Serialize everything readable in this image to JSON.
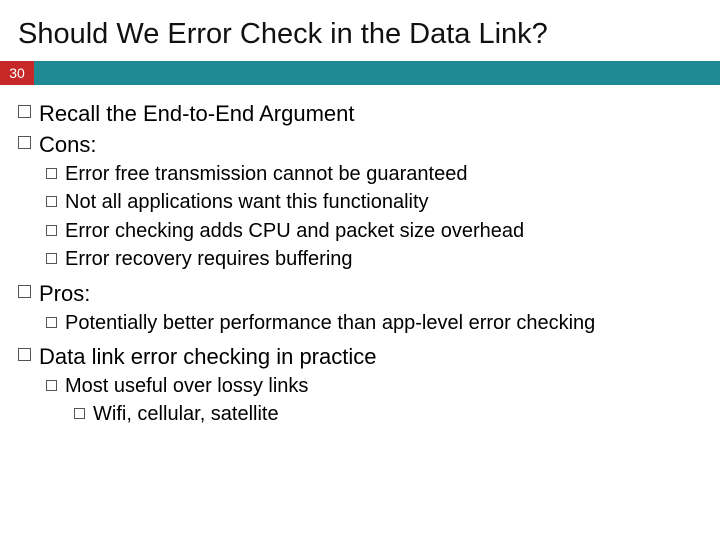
{
  "slide_number": "30",
  "title": "Should We Error Check in the Data Link?",
  "bullets": {
    "b1": "Recall the End-to-End Argument",
    "b2": "Cons:",
    "b2a": "Error free transmission cannot be guaranteed",
    "b2b": "Not all applications want this functionality",
    "b2c": "Error checking adds CPU and packet size overhead",
    "b2d": "Error recovery requires buffering",
    "b3": "Pros:",
    "b3a": "Potentially better performance than app-level error checking",
    "b4": "Data link error checking in practice",
    "b4a": "Most useful over lossy links",
    "b4a1": "Wifi, cellular, satellite"
  }
}
